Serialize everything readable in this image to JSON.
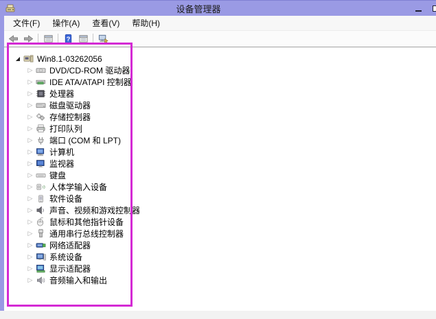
{
  "window": {
    "title": "设备管理器"
  },
  "menu_bar": {
    "items": [
      {
        "id": "file",
        "label": "文件(F)"
      },
      {
        "id": "action",
        "label": "操作(A)"
      },
      {
        "id": "view",
        "label": "查看(V)"
      },
      {
        "id": "help",
        "label": "帮助(H)"
      }
    ]
  },
  "toolbar": {
    "buttons": [
      {
        "name": "back",
        "icon": "back-arrow-icon"
      },
      {
        "name": "forward",
        "icon": "forward-arrow-icon"
      },
      {
        "separator": true
      },
      {
        "name": "console-tree",
        "icon": "window-list-icon"
      },
      {
        "separator": true
      },
      {
        "name": "help",
        "icon": "help-icon"
      },
      {
        "name": "device-list",
        "icon": "window-list-icon"
      },
      {
        "separator": true
      },
      {
        "name": "scan-hardware",
        "icon": "scan-computer-icon"
      }
    ]
  },
  "tree": {
    "root": {
      "label": "Win8.1-03262056",
      "icon": "computer-root-icon",
      "expanded": true
    },
    "items": [
      {
        "label": "DVD/CD-ROM 驱动器",
        "icon": "dvd-drive-icon"
      },
      {
        "label": "IDE ATA/ATAPI 控制器",
        "icon": "ide-controller-icon"
      },
      {
        "label": "处理器",
        "icon": "processor-icon"
      },
      {
        "label": "磁盘驱动器",
        "icon": "disk-drive-icon"
      },
      {
        "label": "存储控制器",
        "icon": "storage-controller-icon"
      },
      {
        "label": "打印队列",
        "icon": "print-queue-icon"
      },
      {
        "label": "端口 (COM 和 LPT)",
        "icon": "serial-port-icon"
      },
      {
        "label": "计算机",
        "icon": "computer-icon"
      },
      {
        "label": "监视器",
        "icon": "monitor-icon"
      },
      {
        "label": "键盘",
        "icon": "keyboard-icon"
      },
      {
        "label": "人体学输入设备",
        "icon": "hid-icon"
      },
      {
        "label": "软件设备",
        "icon": "software-device-icon"
      },
      {
        "label": "声音、视频和游戏控制器",
        "icon": "sound-controller-icon"
      },
      {
        "label": "鼠标和其他指针设备",
        "icon": "mouse-icon"
      },
      {
        "label": "通用串行总线控制器",
        "icon": "usb-icon"
      },
      {
        "label": "网络适配器",
        "icon": "network-adapter-icon"
      },
      {
        "label": "系统设备",
        "icon": "system-device-icon"
      },
      {
        "label": "显示适配器",
        "icon": "display-adapter-icon"
      },
      {
        "label": "音频输入和输出",
        "icon": "audio-io-icon"
      }
    ]
  },
  "annotation": {
    "color": "#d42ad4"
  },
  "theme": {
    "titlebar_color": "#9a9ae4"
  }
}
